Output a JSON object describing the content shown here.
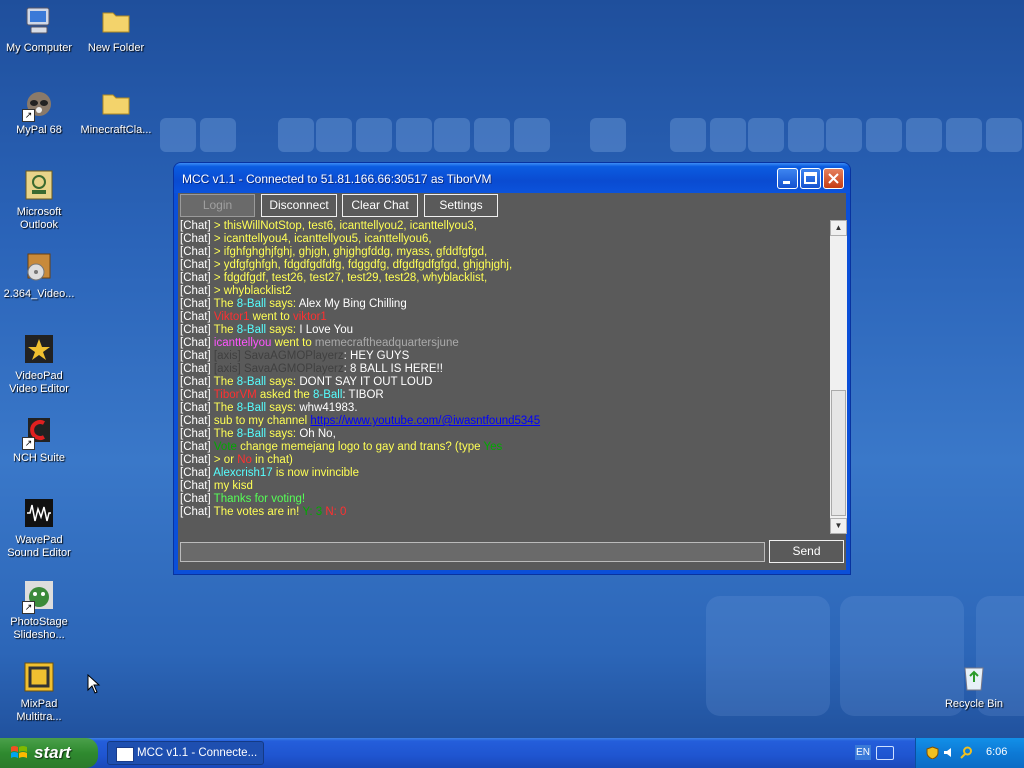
{
  "desktop_icons": [
    {
      "label": "My Computer",
      "icon": "computer-icon"
    },
    {
      "label": "New Folder",
      "icon": "folder-icon"
    },
    {
      "label": "MyPal 68",
      "icon": "raccoon-icon"
    },
    {
      "label": "MinecraftCla...",
      "icon": "folder-icon"
    },
    {
      "label": "Microsoft Outlook",
      "icon": "outlook-icon"
    },
    {
      "label": "2.364_Video...",
      "icon": "media-package-icon"
    },
    {
      "label": "VideoPad Video Editor",
      "icon": "videopad-icon"
    },
    {
      "label": "NCH Suite",
      "icon": "nch-icon"
    },
    {
      "label": "WavePad Sound Editor",
      "icon": "wavepad-icon"
    },
    {
      "label": "PhotoStage Slidesho...",
      "icon": "photostage-icon"
    },
    {
      "label": "MixPad Multitra...",
      "icon": "mixpad-icon"
    },
    {
      "label": "Recycle Bin",
      "icon": "recycle-bin-icon"
    }
  ],
  "window": {
    "title": "MCC v1.1 - Connected to 51.81.166.66:30517 as TiborVM",
    "toolbar": {
      "login": "Login",
      "disconnect": "Disconnect",
      "clear_chat": "Clear Chat",
      "settings": "Settings"
    },
    "send": "Send",
    "input_value": "",
    "colors": {
      "yellow": "#ffff55",
      "aqua": "#55ffff",
      "gold": "#ffaa00",
      "red": "#ff3030",
      "light_purple": "#ff55ff",
      "gray": "#aaaaaa",
      "dark_gray": "#404040",
      "green": "#55ff55",
      "dark_green": "#00aa00",
      "link": "#0000ff",
      "white": "#ffffff"
    },
    "chat_lines": [
      [
        {
          "t": "[Chat] ",
          "c": "white"
        },
        {
          "t": "> thisWillNotStop, test6, icanttellyou2, icanttellyou3,",
          "c": "yellow"
        }
      ],
      [
        {
          "t": "[Chat] ",
          "c": "white"
        },
        {
          "t": "> icanttellyou4, icanttellyou5, icanttellyou6,",
          "c": "yellow"
        }
      ],
      [
        {
          "t": "[Chat] ",
          "c": "white"
        },
        {
          "t": "> ifghfghghjfghj, ghjgh, ghjghgfddg, myass, gfddfgfgd,",
          "c": "yellow"
        }
      ],
      [
        {
          "t": "[Chat] ",
          "c": "white"
        },
        {
          "t": "> ydfgfghfgh, fdgdfgdfdfg, fdggdfg, dfgdfgdfgfgd, ghjghjghj,",
          "c": "yellow"
        }
      ],
      [
        {
          "t": "[Chat] ",
          "c": "white"
        },
        {
          "t": "> fdgdfgdf, test26, test27, test29, test28, whyblacklist,",
          "c": "yellow"
        }
      ],
      [
        {
          "t": "[Chat] ",
          "c": "white"
        },
        {
          "t": "> whyblacklist2",
          "c": "yellow"
        }
      ],
      [
        {
          "t": "[Chat] ",
          "c": "white"
        },
        {
          "t": "The ",
          "c": "yellow"
        },
        {
          "t": "8-Ball",
          "c": "aqua"
        },
        {
          "t": " says: ",
          "c": "yellow"
        },
        {
          "t": "Alex My Bing Chilling",
          "c": "white"
        }
      ],
      [
        {
          "t": "[Chat] ",
          "c": "white"
        },
        {
          "t": "Viktor1",
          "c": "red"
        },
        {
          "t": " went to ",
          "c": "yellow"
        },
        {
          "t": "viktor1",
          "c": "red"
        }
      ],
      [
        {
          "t": "[Chat] ",
          "c": "white"
        },
        {
          "t": "The ",
          "c": "yellow"
        },
        {
          "t": "8-Ball",
          "c": "aqua"
        },
        {
          "t": " says: ",
          "c": "yellow"
        },
        {
          "t": "I Love You",
          "c": "white"
        }
      ],
      [
        {
          "t": "[Chat] ",
          "c": "white"
        },
        {
          "t": "icanttellyou",
          "c": "light_purple"
        },
        {
          "t": " went to ",
          "c": "yellow"
        },
        {
          "t": "memecraftheadquartersjune",
          "c": "gray"
        }
      ],
      [
        {
          "t": "[Chat] ",
          "c": "white"
        },
        {
          "t": "[axis] ",
          "c": "dark_gray"
        },
        {
          "t": "SavaAGMOPlayerz",
          "c": "dark_gray"
        },
        {
          "t": ": HEY GUYS",
          "c": "white"
        }
      ],
      [
        {
          "t": "[Chat] ",
          "c": "white"
        },
        {
          "t": "[axis] ",
          "c": "dark_gray"
        },
        {
          "t": "SavaAGMOPlayerz",
          "c": "dark_gray"
        },
        {
          "t": ": 8 BALL IS HERE!!",
          "c": "white"
        }
      ],
      [
        {
          "t": "[Chat] ",
          "c": "white"
        },
        {
          "t": "The ",
          "c": "yellow"
        },
        {
          "t": "8-Ball",
          "c": "aqua"
        },
        {
          "t": " says: ",
          "c": "yellow"
        },
        {
          "t": "DONT SAY IT OUT LOUD",
          "c": "white"
        }
      ],
      [
        {
          "t": "[Chat] ",
          "c": "white"
        },
        {
          "t": "TiborVM",
          "c": "red"
        },
        {
          "t": " asked the ",
          "c": "yellow"
        },
        {
          "t": "8-Ball",
          "c": "aqua"
        },
        {
          "t": ": TIBOR",
          "c": "white"
        }
      ],
      [
        {
          "t": "[Chat] ",
          "c": "white"
        },
        {
          "t": "The ",
          "c": "yellow"
        },
        {
          "t": "8-Ball",
          "c": "aqua"
        },
        {
          "t": " says: ",
          "c": "yellow"
        },
        {
          "t": "whw41983.",
          "c": "white"
        }
      ],
      [
        {
          "t": "[Chat] ",
          "c": "white"
        },
        {
          "t": "sub to my channel ",
          "c": "yellow"
        },
        {
          "t": "https://www.youtube.com/@iwasntfound5345",
          "c": "link"
        }
      ],
      [
        {
          "t": "[Chat] ",
          "c": "white"
        },
        {
          "t": "The ",
          "c": "yellow"
        },
        {
          "t": "8-Ball",
          "c": "aqua"
        },
        {
          "t": " says: ",
          "c": "yellow"
        },
        {
          "t": "Oh No,",
          "c": "white"
        }
      ],
      [
        {
          "t": "[Chat] ",
          "c": "white"
        },
        {
          "t": "Vote",
          "c": "dark_green"
        },
        {
          "t": " change memejang logo to gay and trans? (type ",
          "c": "yellow"
        },
        {
          "t": "Yes",
          "c": "dark_green"
        }
      ],
      [
        {
          "t": "[Chat] ",
          "c": "white"
        },
        {
          "t": "> or ",
          "c": "yellow"
        },
        {
          "t": "No",
          "c": "red"
        },
        {
          "t": " in chat)",
          "c": "yellow"
        }
      ],
      [
        {
          "t": "[Chat] ",
          "c": "white"
        },
        {
          "t": "Alexcrish17",
          "c": "aqua"
        },
        {
          "t": " is now invincible",
          "c": "yellow"
        }
      ],
      [
        {
          "t": "[Chat] ",
          "c": "white"
        },
        {
          "t": "my kisd",
          "c": "yellow"
        }
      ],
      [
        {
          "t": "[Chat] ",
          "c": "white"
        },
        {
          "t": "Thanks for voting!",
          "c": "green"
        }
      ],
      [
        {
          "t": "[Chat] ",
          "c": "white"
        },
        {
          "t": "The votes are in! ",
          "c": "yellow"
        },
        {
          "t": "Y: 3",
          "c": "dark_green"
        },
        {
          "t": " N: 0",
          "c": "red"
        }
      ]
    ]
  },
  "taskbar": {
    "start": "start",
    "task_label": "MCC v1.1 - Connecte...",
    "lang": "EN",
    "clock": "6:06"
  }
}
